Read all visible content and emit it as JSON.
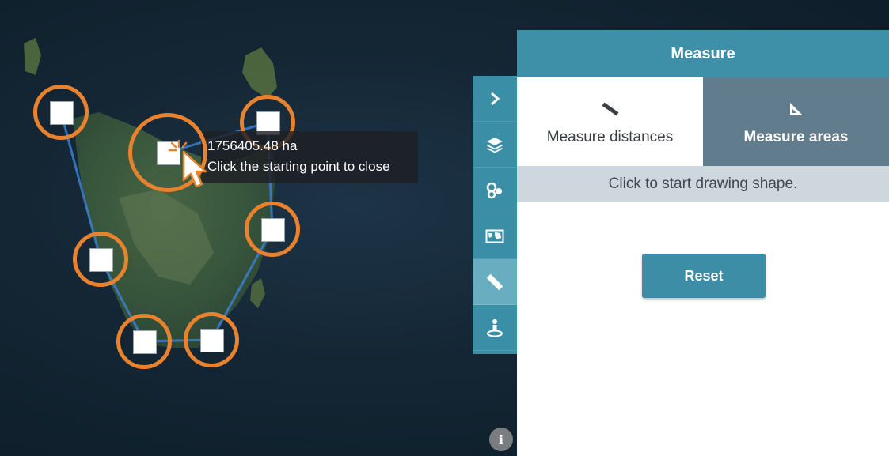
{
  "map": {
    "tooltip": {
      "area": "1756405.48 ha",
      "hint": "Click the starting point to close"
    },
    "info_label": "i"
  },
  "toolbar": {
    "items": [
      {
        "icon": "chevron-right-icon"
      },
      {
        "icon": "layers-icon"
      },
      {
        "icon": "analysis-icon"
      },
      {
        "icon": "basemap-icon"
      },
      {
        "icon": "ruler-icon",
        "active": true
      },
      {
        "icon": "location-person-icon"
      }
    ]
  },
  "panel": {
    "title": "Measure",
    "tabs": [
      {
        "label": "Measure distances",
        "icon": "ruler-icon",
        "selected": true
      },
      {
        "label": "Measure areas",
        "icon": "set-square-icon",
        "selected": false
      }
    ],
    "instruction": "Click to start drawing shape.",
    "reset_label": "Reset"
  },
  "colors": {
    "panel_header": "#3d90a7",
    "toolbar": "#3a8fa6",
    "unselected_tab": "#607c8d",
    "vertex_ring": "#e8822e",
    "polygon_line": "#3b7fd0"
  }
}
